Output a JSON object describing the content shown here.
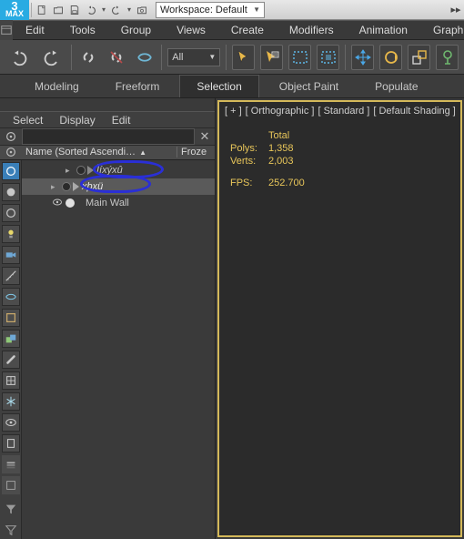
{
  "topbar": {
    "logo_big": "3",
    "logo_small": "MAX",
    "workspace_label": "Workspace: Default"
  },
  "menubar": {
    "items": [
      "Edit",
      "Tools",
      "Group",
      "Views",
      "Create",
      "Modifiers",
      "Animation",
      "Graph"
    ]
  },
  "toolbar": {
    "filter_label": "All"
  },
  "ribbon": {
    "tabs": [
      "Modeling",
      "Freeform",
      "Selection",
      "Object Paint",
      "Populate"
    ],
    "active_index": 2
  },
  "explorer": {
    "menu": [
      "Select",
      "Display",
      "Edit"
    ],
    "header_name": "Name (Sorted Ascendi…",
    "header_frozen": "Froze",
    "rows": [
      {
        "indent": 44,
        "eye": false,
        "dot": "d",
        "tri": true,
        "label": "Ìíxýxû",
        "italic": true,
        "sel": false
      },
      {
        "indent": 28,
        "eye": false,
        "dot": "d",
        "tri": true,
        "label": "xþxü",
        "italic": true,
        "sel": true
      },
      {
        "indent": 28,
        "eye": true,
        "dot": "w",
        "tri": false,
        "label": "Main Wall",
        "italic": false,
        "sel": false
      }
    ]
  },
  "viewport": {
    "labels": [
      "[ + ]",
      "[ Orthographic ]",
      "[ Standard ]",
      "[ Default Shading ]"
    ],
    "stats": {
      "total_hdr": "Total",
      "polys_label": "Polys:",
      "polys_value": "1,358",
      "verts_label": "Verts:",
      "verts_value": "2,003",
      "fps_label": "FPS:",
      "fps_value": "252.700"
    }
  }
}
